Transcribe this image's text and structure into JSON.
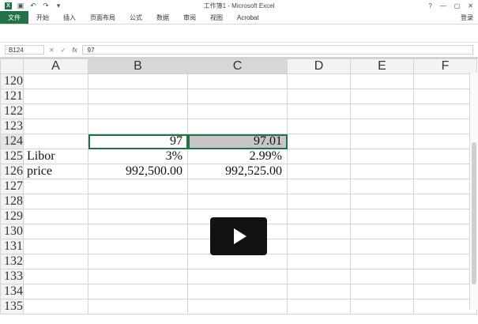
{
  "window": {
    "title": "工作簿1 - Microsoft Excel",
    "help": "?",
    "account": "登录"
  },
  "ribbon": {
    "file": "文件",
    "tabs": [
      "开始",
      "插入",
      "页面布局",
      "公式",
      "数据",
      "审阅",
      "视图",
      "Acrobat"
    ]
  },
  "formula_bar": {
    "name_box": "B124",
    "formula": "97"
  },
  "sheet": {
    "columns": [
      "A",
      "B",
      "C",
      "D",
      "E",
      "F"
    ],
    "rows": [
      {
        "n": "120",
        "A": "",
        "B": "",
        "C": ""
      },
      {
        "n": "121",
        "A": "",
        "B": "",
        "C": ""
      },
      {
        "n": "122",
        "A": "",
        "B": "",
        "C": ""
      },
      {
        "n": "123",
        "A": "",
        "B": "",
        "C": ""
      },
      {
        "n": "124",
        "A": "",
        "B": "97",
        "C": "97.01"
      },
      {
        "n": "125",
        "A": "Libor",
        "B": "3%",
        "C": "2.99%"
      },
      {
        "n": "126",
        "A": "price",
        "B": "992,500.00",
        "C": "992,525.00"
      },
      {
        "n": "127",
        "A": "",
        "B": "",
        "C": ""
      },
      {
        "n": "128",
        "A": "",
        "B": "",
        "C": ""
      },
      {
        "n": "129",
        "A": "",
        "B": "",
        "C": ""
      },
      {
        "n": "130",
        "A": "",
        "B": "",
        "C": ""
      },
      {
        "n": "131",
        "A": "",
        "B": "",
        "C": ""
      },
      {
        "n": "132",
        "A": "",
        "B": "",
        "C": ""
      },
      {
        "n": "133",
        "A": "",
        "B": "",
        "C": ""
      },
      {
        "n": "134",
        "A": "",
        "B": "",
        "C": ""
      },
      {
        "n": "135",
        "A": "",
        "B": "",
        "C": ""
      }
    ]
  },
  "colors": {
    "excel_green": "#217346",
    "grid": "#d4d4d4",
    "selected_fill": "#c6c6c6"
  },
  "icons": {
    "app": "excel-icon",
    "save": "save-icon",
    "undo": "undo-icon",
    "redo": "redo-icon",
    "play": "play-icon"
  }
}
